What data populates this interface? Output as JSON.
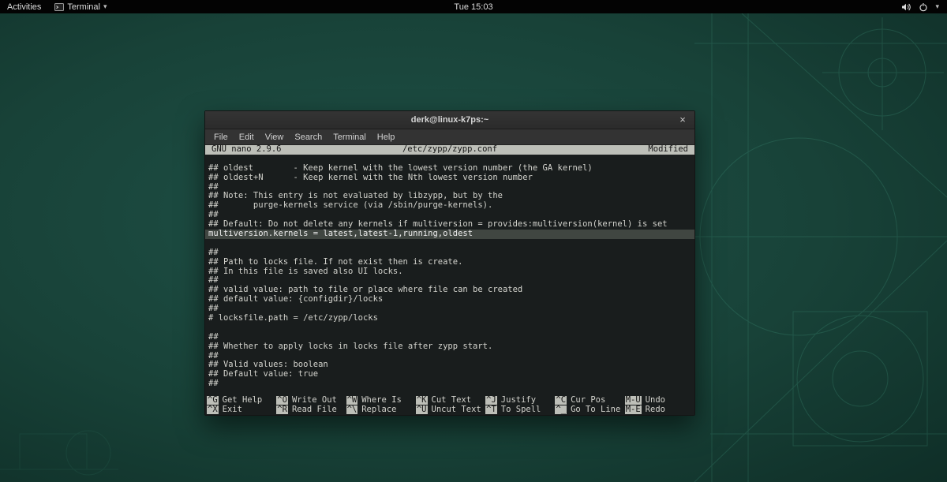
{
  "top_bar": {
    "activities": "Activities",
    "app_menu": "Terminal",
    "clock": "Tue 15:03"
  },
  "window": {
    "title": "derk@linux-k7ps:~",
    "close_label": "×",
    "menus": [
      "File",
      "Edit",
      "View",
      "Search",
      "Terminal",
      "Help"
    ]
  },
  "nano": {
    "header": {
      "version": "GNU nano 2.9.6",
      "file": "/etc/zypp/zypp.conf",
      "status": "Modified"
    },
    "lines": [
      {
        "text": "## oldest        - Keep kernel with the lowest version number (the GA kernel)",
        "highlight": false
      },
      {
        "text": "## oldest+N      - Keep kernel with the Nth lowest version number",
        "highlight": false
      },
      {
        "text": "##",
        "highlight": false
      },
      {
        "text": "## Note: This entry is not evaluated by libzypp, but by the",
        "highlight": false
      },
      {
        "text": "##       purge-kernels service (via /sbin/purge-kernels).",
        "highlight": false
      },
      {
        "text": "##",
        "highlight": false
      },
      {
        "text": "## Default: Do not delete any kernels if multiversion = provides:multiversion(kernel) is set",
        "highlight": false
      },
      {
        "text": "multiversion.kernels = latest,latest-1,running,oldest",
        "highlight": true
      },
      {
        "text": "",
        "highlight": false
      },
      {
        "text": "##",
        "highlight": false
      },
      {
        "text": "## Path to locks file. If not exist then is create.",
        "highlight": false
      },
      {
        "text": "## In this file is saved also UI locks.",
        "highlight": false
      },
      {
        "text": "##",
        "highlight": false
      },
      {
        "text": "## valid value: path to file or place where file can be created",
        "highlight": false
      },
      {
        "text": "## default value: {configdir}/locks",
        "highlight": false
      },
      {
        "text": "##",
        "highlight": false
      },
      {
        "text": "# locksfile.path = /etc/zypp/locks",
        "highlight": false
      },
      {
        "text": "",
        "highlight": false
      },
      {
        "text": "##",
        "highlight": false
      },
      {
        "text": "## Whether to apply locks in locks file after zypp start.",
        "highlight": false
      },
      {
        "text": "##",
        "highlight": false
      },
      {
        "text": "## Valid values: boolean",
        "highlight": false
      },
      {
        "text": "## Default value: true",
        "highlight": false
      },
      {
        "text": "##",
        "highlight": false
      }
    ],
    "shortcuts_row1": [
      [
        "^G",
        "Get Help"
      ],
      [
        "^O",
        "Write Out"
      ],
      [
        "^W",
        "Where Is"
      ],
      [
        "^K",
        "Cut Text"
      ],
      [
        "^J",
        "Justify"
      ],
      [
        "^C",
        "Cur Pos"
      ],
      [
        "M-U",
        "Undo"
      ]
    ],
    "shortcuts_row2": [
      [
        "^X",
        "Exit"
      ],
      [
        "^R",
        "Read File"
      ],
      [
        "^\\",
        "Replace"
      ],
      [
        "^U",
        "Uncut Text"
      ],
      [
        "^T",
        "To Spell"
      ],
      [
        "^_",
        "Go To Line"
      ],
      [
        "M-E",
        "Redo"
      ]
    ]
  }
}
